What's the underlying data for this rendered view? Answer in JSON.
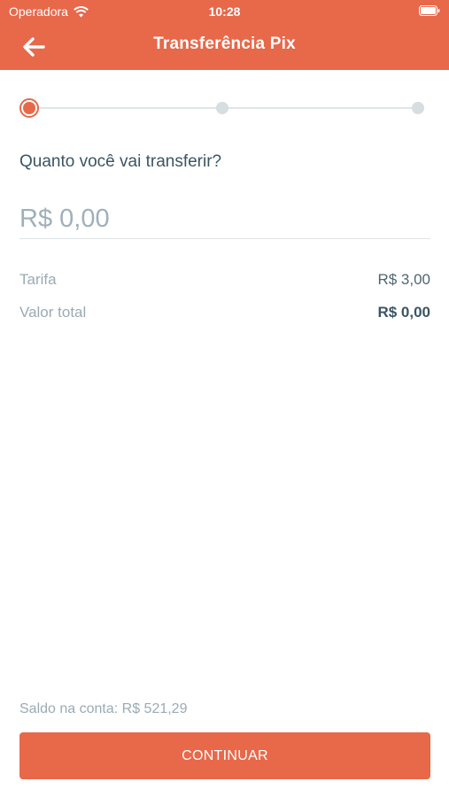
{
  "status_bar": {
    "carrier": "Operadora",
    "time": "10:28"
  },
  "header": {
    "title": "Transferência Pix",
    "back_icon": "arrow-left-icon"
  },
  "stepper": {
    "total_steps": 3,
    "current_step": 1
  },
  "main": {
    "question": "Quanto você vai transferir?",
    "amount_placeholder": "R$ 0,00",
    "amount_value": "",
    "fee_label": "Tarifa",
    "fee_value": "R$ 3,00",
    "total_label": "Valor total",
    "total_value": "R$ 0,00"
  },
  "footer": {
    "balance": "Saldo na conta: R$ 521,29",
    "continue_label": "CONTINUAR"
  },
  "colors": {
    "accent": "#e8684a",
    "text_dark": "#3b5563",
    "text_muted": "#9aabb4"
  }
}
